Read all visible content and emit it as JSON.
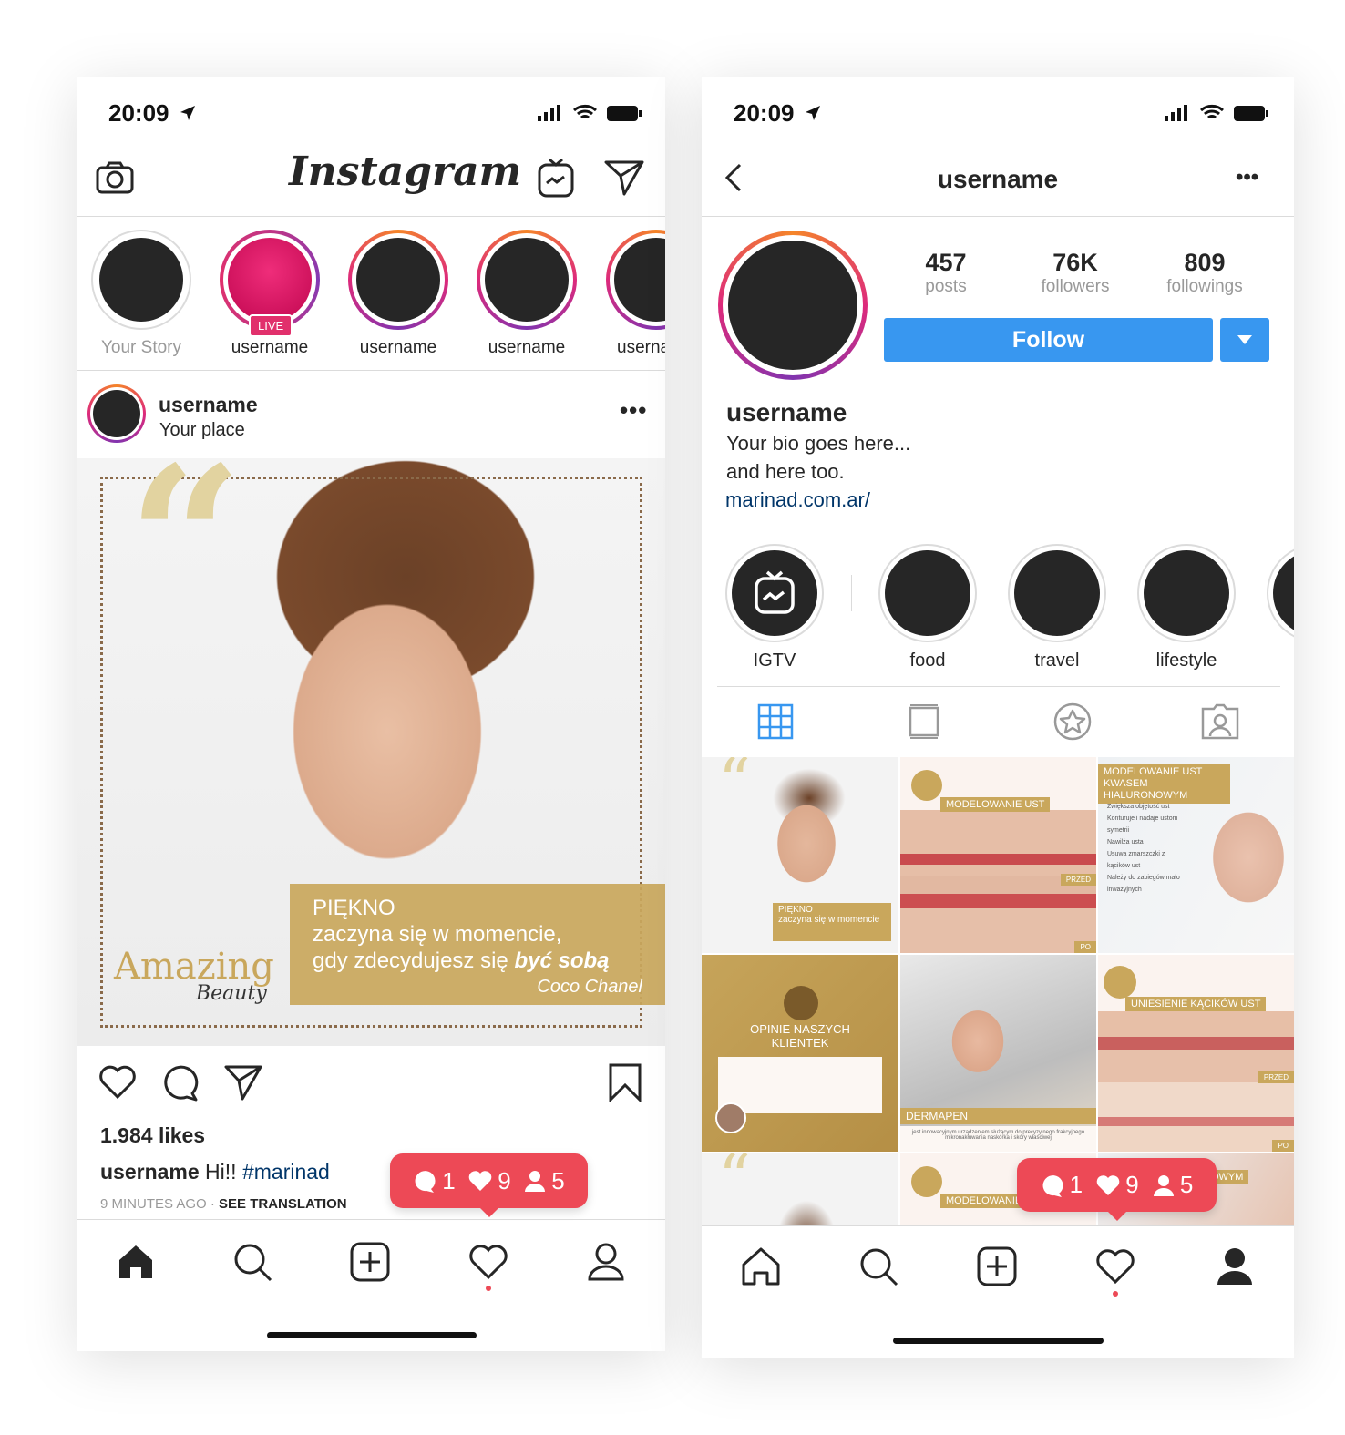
{
  "feed": {
    "status": {
      "time": "20:09"
    },
    "header": {
      "logo": "Instagram",
      "icons": [
        "camera-icon",
        "igtv-icon",
        "direct-message-icon"
      ]
    },
    "stories": [
      {
        "label": "Your Story",
        "live": false
      },
      {
        "label": "username",
        "live": true,
        "live_badge": "LIVE"
      },
      {
        "label": "username"
      },
      {
        "label": "username"
      },
      {
        "label": "userna"
      }
    ],
    "post": {
      "username": "username",
      "location": "Your place",
      "image": {
        "brand": "Amazing",
        "brand_sub": "Beauty",
        "quote_title": "PIĘKNO",
        "quote_line1": "zaczyna się w momencie,",
        "quote_line2": "gdy zdecydujesz się ",
        "quote_emph": "być sobą",
        "quote_author": "Coco Chanel"
      },
      "likes": "1.984 likes",
      "caption_user": "username",
      "caption_text": " Hi!! ",
      "hashtag": "#marinad",
      "time_ago": "9 MINUTES AGO",
      "separator": "·",
      "see_translation": "SEE TRANSLATION"
    },
    "notification": {
      "comments": "1",
      "likes": "9",
      "follows": "5"
    },
    "nav": [
      "home-icon",
      "search-icon",
      "add-icon",
      "activity-icon",
      "profile-icon"
    ]
  },
  "profile": {
    "status": {
      "time": "20:09"
    },
    "header": {
      "title": "username"
    },
    "stats": [
      {
        "value": "457",
        "label": "posts"
      },
      {
        "value": "76K",
        "label": "followers"
      },
      {
        "value": "809",
        "label": "followings"
      }
    ],
    "follow_label": "Follow",
    "name": "username",
    "bio1": "Your bio goes here...",
    "bio2": "and here too.",
    "link": "marinad.com.ar/",
    "highlights": [
      {
        "label": "IGTV"
      },
      {
        "label": "food"
      },
      {
        "label": "travel"
      },
      {
        "label": "lifestyle"
      },
      {
        "label": ""
      }
    ],
    "tabs": [
      "grid-icon",
      "feed-icon",
      "tagged-star-icon",
      "tagged-person-icon"
    ],
    "grid": [
      {
        "caption": "PIĘKNO",
        "sub": "zaczyna się w momencie"
      },
      {
        "caption": "MODELOWANIE UST",
        "before": "PRZED",
        "after": "PO"
      },
      {
        "caption": "MODELOWANIE UST KWASEM HIALURONOWYM",
        "items": [
          "Zwiększa objętość ust",
          "Konturuje i nadaje ustom symetrii",
          "Nawilża usta",
          "Usuwa zmarszczki z kącików ust",
          "Należy do zabiegów mało inwazyjnych"
        ]
      },
      {
        "caption": "OPINIE NASZYCH KLIENTEK"
      },
      {
        "caption": "DERMAPEN",
        "sub": "jest innowacyjnym urządzeniem służącym do precyzyjnego frakcyjnego mikronakłuwania naskórka i skóry właściwej"
      },
      {
        "caption": "UNIESIENIE KĄCIKÓW UST",
        "before": "PRZED",
        "after": "PO"
      },
      {
        "caption": ""
      },
      {
        "caption": "MODELOWANIE"
      },
      {
        "caption": "NOWYM"
      }
    ],
    "notification": {
      "comments": "1",
      "likes": "9",
      "follows": "5"
    },
    "accent": "#3897f0",
    "notification_color": "#ed4956"
  }
}
